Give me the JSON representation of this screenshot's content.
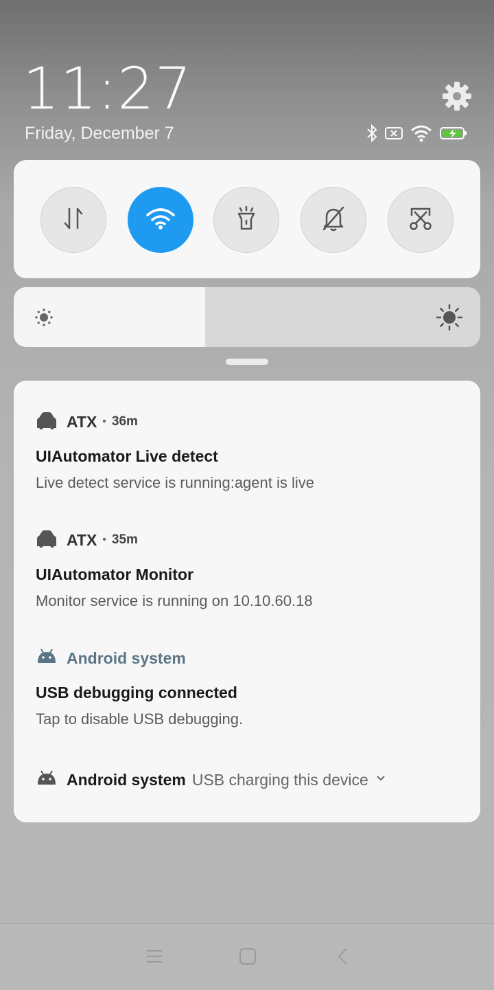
{
  "status": {
    "time": "11:27",
    "date": "Friday, December 7",
    "icons": [
      "bluetooth-icon",
      "no-sim-icon",
      "wifi-icon",
      "battery-charging-icon"
    ]
  },
  "quick_settings": [
    {
      "name": "mobile-data",
      "icon": "data-arrows-icon",
      "active": false
    },
    {
      "name": "wifi",
      "icon": "wifi-icon",
      "active": true
    },
    {
      "name": "flashlight",
      "icon": "flashlight-icon",
      "active": false
    },
    {
      "name": "silent",
      "icon": "bell-off-icon",
      "active": false
    },
    {
      "name": "screenshot",
      "icon": "scissors-icon",
      "active": false
    }
  ],
  "brightness": {
    "level": 0.41
  },
  "notifications": [
    {
      "app": "ATX",
      "time": "36m",
      "title": "UIAutomator Live detect",
      "text": "Live detect service is running:agent is live"
    },
    {
      "app": "ATX",
      "time": "35m",
      "title": "UIAutomator Monitor",
      "text": "Monitor service is running on 10.10.60.18"
    },
    {
      "app": "Android system",
      "time": "",
      "title": "USB debugging connected",
      "text": "Tap to disable USB debugging."
    }
  ],
  "collapsed_notification": {
    "app": "Android system",
    "text": "USB charging this device"
  },
  "navbar": [
    "menu-icon",
    "home-icon",
    "back-icon"
  ],
  "colors": {
    "accent": "#1e9bf0",
    "android_app": "#5a7585"
  }
}
